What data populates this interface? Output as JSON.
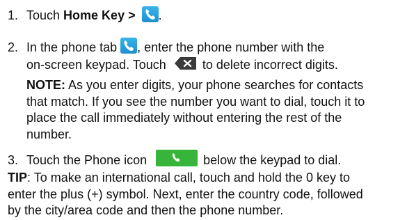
{
  "steps": [
    {
      "number": "1.",
      "text_before": "Touch ",
      "bold": "Home Key >",
      "icon": "phone-app-icon",
      "text_after": "."
    },
    {
      "number": "2.",
      "line1_before": "In the phone tab",
      "icon1": "phone-app-icon",
      "line1_after": ", enter the phone number with the",
      "line2_before": "on-screen keypad. Touch",
      "icon2": "delete-key-icon",
      "line2_after": "to delete incorrect digits."
    },
    {
      "number": "3.",
      "text_before": "Touch the Phone icon",
      "icon": "green-phone-button-icon",
      "text_after": "below the keypad to dial."
    }
  ],
  "note": {
    "label": "NOTE:",
    "lines": [
      " As you enter digits, your phone searches for contacts",
      "that match. If you see the number you want to dial, touch it to",
      "place the call immediately without entering the rest of the",
      "number."
    ]
  },
  "tip": {
    "label": "TIP",
    "lines": [
      ": To make an international call, touch and hold the 0 key to",
      "enter the plus (+) symbol. Next, enter the country code, followed",
      "by the city/area code and then the phone number."
    ]
  },
  "colors": {
    "phone_icon_blue": "#1d8fd0",
    "phone_button_green": "#36b53a",
    "delete_key_dark": "#3a3a3a"
  }
}
